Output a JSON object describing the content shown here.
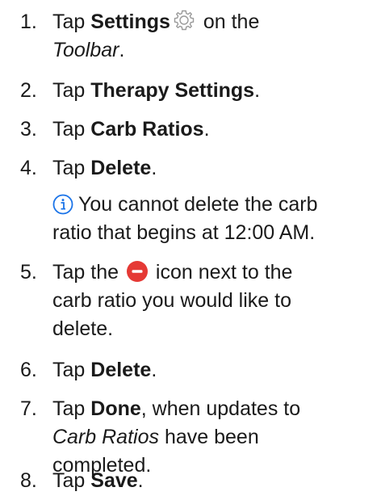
{
  "steps": [
    {
      "number": "1.",
      "line1_a": "Tap ",
      "line1_b": "Settings",
      "line1_c": " on the",
      "line2": "Toolbar",
      "line2_end": "."
    },
    {
      "number": "2.",
      "a": "Tap ",
      "b": "Therapy Settings",
      "c": "."
    },
    {
      "number": "3.",
      "a": "Tap ",
      "b": "Carb Ratios",
      "c": "."
    },
    {
      "number": "4.",
      "a": "Tap ",
      "b": "Delete",
      "c": ".",
      "note_line1": "You cannot delete the carb",
      "note_line2": "ratio that begins at 12:00 AM."
    },
    {
      "number": "5.",
      "line1_a": "Tap the ",
      "line1_c": " icon next to the",
      "line2": "carb ratio you would like to",
      "line3": "delete."
    },
    {
      "number": "6.",
      "a": "Tap ",
      "b": "Delete",
      "c": "."
    },
    {
      "number": "7.",
      "line1_a": "Tap ",
      "line1_b": "Done",
      "line1_c": ", when updates to",
      "line2_a": "Carb Ratios",
      "line2_b": " have been",
      "line3": "completed."
    },
    {
      "number": "8.",
      "a": "Tap ",
      "b": "Save",
      "c": "."
    }
  ],
  "icons": {
    "settings": "gear-icon",
    "info": "info-icon",
    "delete": "minus-circle-icon",
    "info_color": "#1a73e8",
    "delete_color": "#e53935"
  }
}
